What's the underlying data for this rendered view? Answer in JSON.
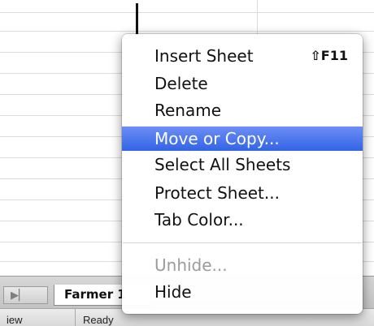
{
  "sheet_tabs": {
    "nav_glyph": "▶▏",
    "active_tab": "Farmer 1"
  },
  "status_bar": {
    "view_label": "iew",
    "status": "Ready"
  },
  "context_menu": {
    "items": [
      {
        "label": "Insert Sheet",
        "shortcut": "⇧F11",
        "state": "normal"
      },
      {
        "label": "Delete",
        "state": "normal"
      },
      {
        "label": "Rename",
        "state": "normal"
      },
      {
        "label": "Move or Copy...",
        "state": "highlighted"
      },
      {
        "label": "Select All Sheets",
        "state": "normal"
      },
      {
        "label": "Protect Sheet...",
        "state": "normal"
      },
      {
        "label": "Tab Color...",
        "state": "normal"
      },
      {
        "label": "Unhide...",
        "state": "disabled"
      },
      {
        "label": "Hide",
        "state": "normal"
      }
    ]
  },
  "colors": {
    "highlight": "#3a6cea",
    "disabled_text": "#9c9c9c"
  }
}
